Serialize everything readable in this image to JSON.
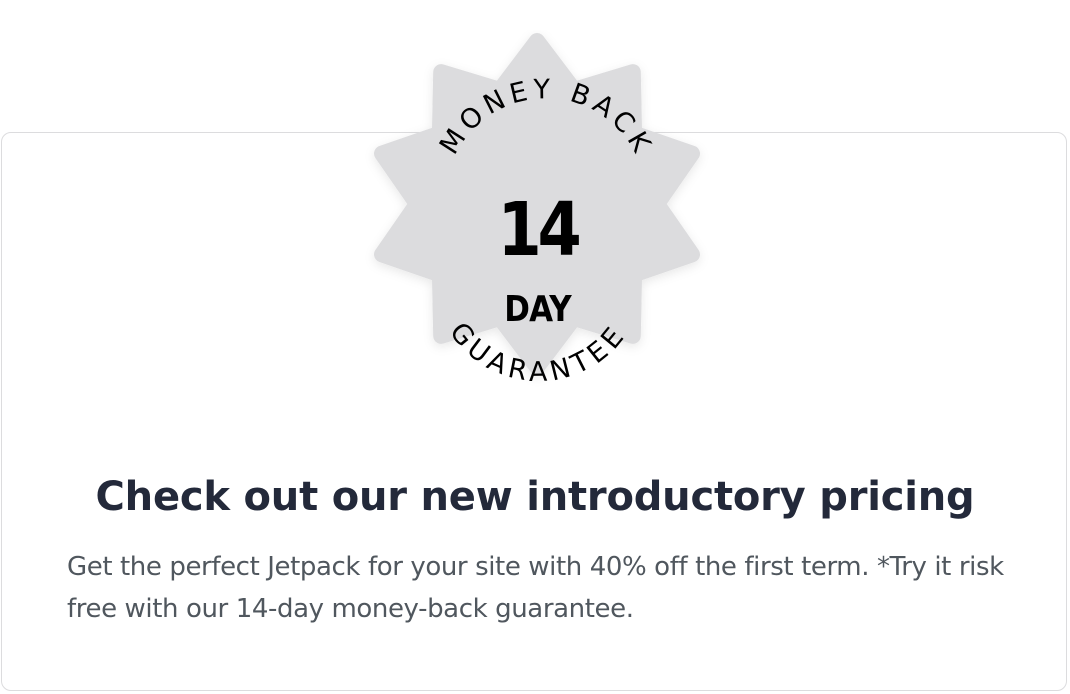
{
  "badge": {
    "top_text": "MONEY BACK",
    "number": "14",
    "unit": "DAY",
    "bottom_text": "GUARANTEE",
    "fill_color": "#dcdcde",
    "text_color": "#000000"
  },
  "title": "Check out our new introductory pricing",
  "description": "Get the perfect Jetpack for your site with 40% off the first term. *Try it risk free with our 14-day money-back guarantee.",
  "colors": {
    "title": "#23293a",
    "description": "#50575e",
    "card_border": "#dcdcde"
  }
}
